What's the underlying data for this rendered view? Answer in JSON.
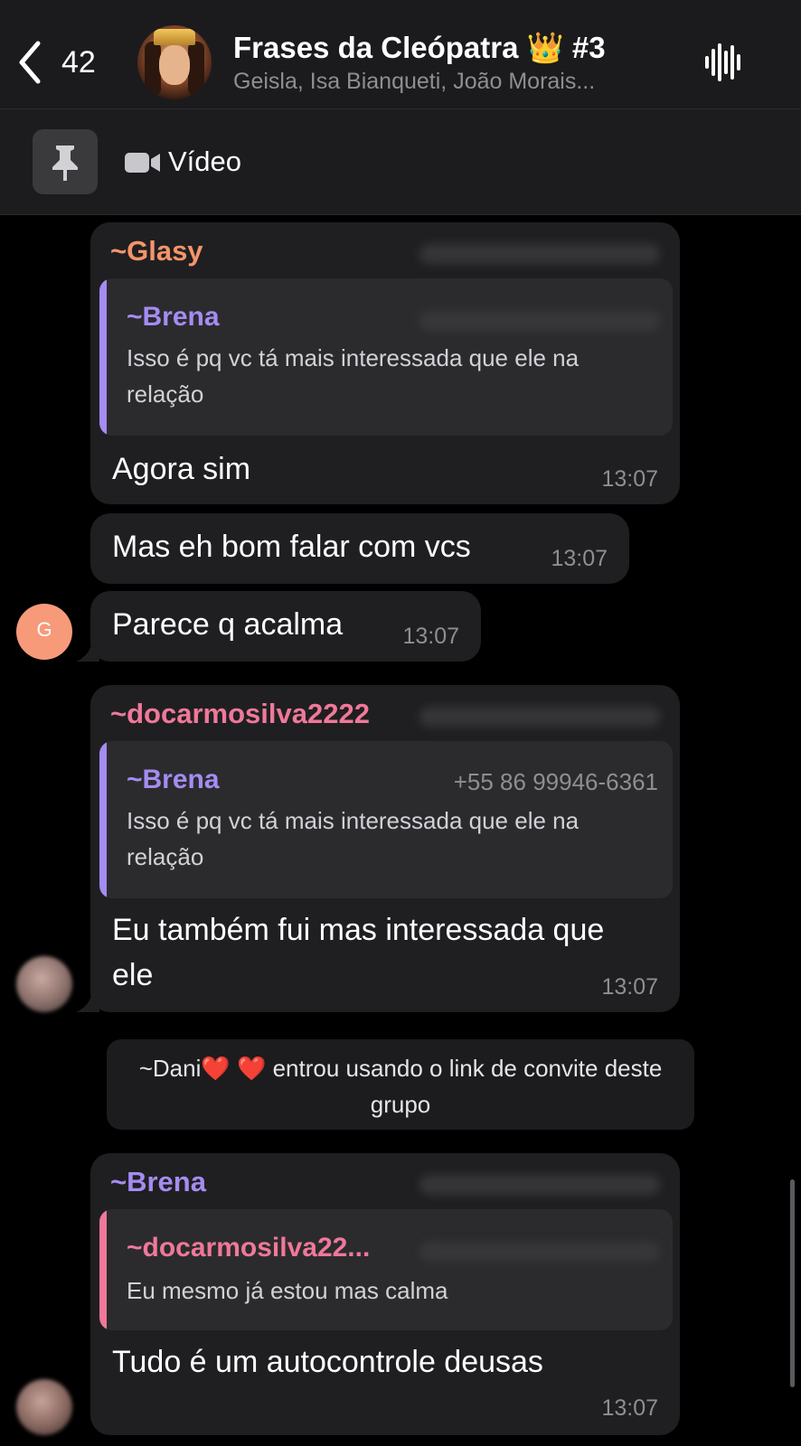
{
  "header": {
    "back_count": "42",
    "title": "Frases da Cleópatra 👑 #3",
    "subtitle": "Geisla, Isa Bianqueti, João Morais..."
  },
  "pinned": {
    "label": "Vídeo"
  },
  "messages": [
    {
      "sender": "~Glasy",
      "sender_color": "#f5946a",
      "quote_name": "~Brena",
      "quote_color": "#a48cf2",
      "quote_text": "Isso é pq vc tá mais interessada que ele na relação",
      "text": "Agora sim",
      "time": "13:07"
    },
    {
      "text": "Mas eh bom falar com vcs",
      "time": "13:07"
    },
    {
      "text": "Parece q acalma",
      "time": "13:07",
      "avatar_initial": "G"
    },
    {
      "sender": "~docarmosilva2222",
      "sender_color": "#f0789a",
      "quote_name": "~Brena",
      "quote_phone": "+55 86 99946-6361",
      "quote_text": "Isso é pq vc tá mais interessada que ele na relação",
      "text": "Eu também fui mas interessada que ele",
      "time": "13:07"
    },
    {
      "sender": "~Brena",
      "sender_color": "#a48cf2",
      "quote_name": "~docarmosilva22...",
      "quote_color": "#f0789a",
      "quote_text": "Eu mesmo já estou mas calma",
      "text": "Tudo é um autocontrole deusas",
      "time": "13:07"
    }
  ],
  "system_message": {
    "name": "~Dani❤️ ❤️",
    "text": "entrou usando o link de convite deste grupo"
  },
  "icons": {
    "back": "chevron-left-icon",
    "voice": "waveform-icon",
    "pin": "pin-icon",
    "video": "video-camera-icon"
  },
  "colors": {
    "accent_purple": "#a48cf2",
    "accent_orange": "#f5946a",
    "accent_pink": "#f0789a",
    "avatar_g": "#f79a7a"
  }
}
